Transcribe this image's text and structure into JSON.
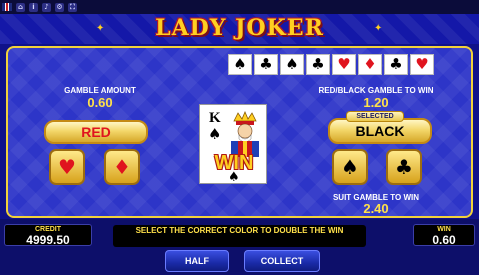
{
  "topbar": {
    "icons": [
      "flag-icon",
      "home-icon",
      "info-icon",
      "sound-icon",
      "settings-icon",
      "fullscreen-icon"
    ]
  },
  "title": "LADY JOKER",
  "history": [
    "♠",
    "♣",
    "♠",
    "♣",
    "♥",
    "♦",
    "♣",
    "♥"
  ],
  "gamble_amount": {
    "label": "GAMBLE AMOUNT",
    "value": "0.60"
  },
  "red_black": {
    "label": "RED/BLACK GAMBLE TO WIN",
    "value": "1.20"
  },
  "suit_gamble": {
    "label": "SUIT GAMBLE TO WIN",
    "value": "2.40"
  },
  "buttons": {
    "red": "RED",
    "black": "BLACK",
    "selected_tag": "SELECTED",
    "hearts": "♥",
    "diamonds": "♦",
    "spades": "♠",
    "clubs": "♣"
  },
  "card": {
    "rank": "K",
    "suit": "♠",
    "result": "WIN"
  },
  "credit": {
    "label": "CREDIT",
    "value": "4999.50"
  },
  "win": {
    "label": "WIN",
    "value": "0.60"
  },
  "message": "SELECT THE CORRECT COLOR TO DOUBLE THE WIN",
  "half": "HALF",
  "collect": "COLLECT",
  "colors": {
    "red_suit": "#e0141e",
    "black_suit": "#000000",
    "gold": "#ffcf21",
    "panel_blue": "#2d35c8"
  }
}
